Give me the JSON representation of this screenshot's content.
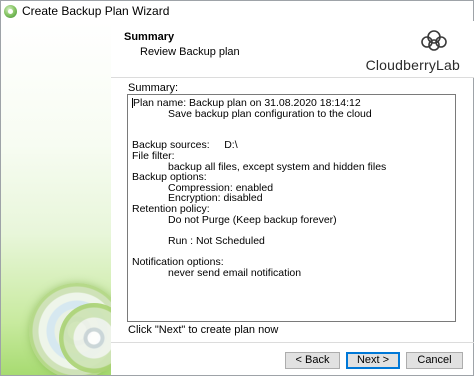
{
  "window": {
    "title": "Create Backup Plan Wizard"
  },
  "header": {
    "title": "Summary",
    "subtitle": "Review Backup plan",
    "logo_text": "CloudberryLab"
  },
  "summary": {
    "label": "Summary:",
    "lines": [
      {
        "text": "Plan name: Backup plan on 31.08.2020 18:14:12",
        "indent": false
      },
      {
        "text": "Save backup plan configuration to the cloud",
        "indent": true
      },
      {
        "text": "",
        "indent": false
      },
      {
        "text": "",
        "indent": false
      },
      {
        "text": "Backup sources:     D:\\",
        "indent": false
      },
      {
        "text": "File filter:",
        "indent": false
      },
      {
        "text": "backup all files, except system and hidden files",
        "indent": true
      },
      {
        "text": "Backup options:",
        "indent": false
      },
      {
        "text": "Compression: enabled",
        "indent": true
      },
      {
        "text": "Encryption: disabled",
        "indent": true
      },
      {
        "text": "Retention policy:",
        "indent": false
      },
      {
        "text": "Do not Purge (Keep backup forever)",
        "indent": true
      },
      {
        "text": "",
        "indent": false
      },
      {
        "text": "Run : Not Scheduled",
        "indent": true
      },
      {
        "text": "",
        "indent": false
      },
      {
        "text": "Notification options:",
        "indent": false
      },
      {
        "text": "never send email notification",
        "indent": true
      }
    ]
  },
  "hint": "Click \"Next\" to create plan now",
  "buttons": {
    "back": "< Back",
    "next": "Next >",
    "cancel": "Cancel"
  },
  "colors": {
    "accent": "#0078d7",
    "side_panel_green": "#a7db71"
  },
  "icons": {
    "app": "backup-app-icon",
    "logo": "cloudberry-logo-icon",
    "disc": "disc-illustration"
  }
}
